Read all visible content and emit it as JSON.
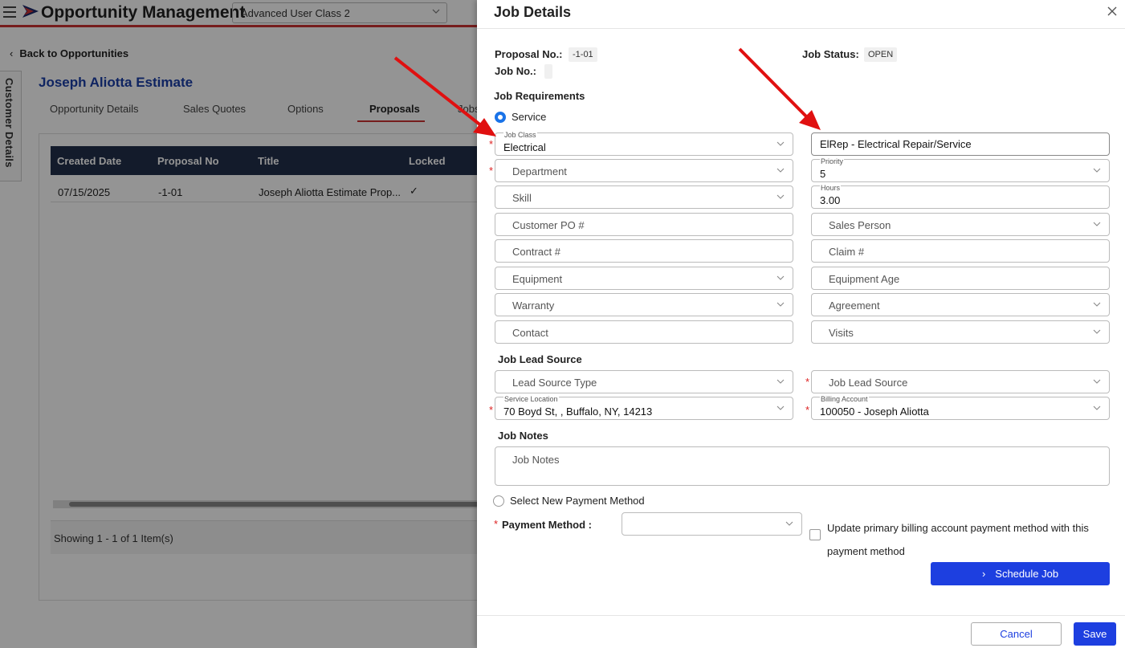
{
  "app": {
    "title": "Opportunity Management",
    "class_select": "Advanced User Class 2",
    "back_link": "Back to Opportunities",
    "side_tab": "Customer Details",
    "customer_title": "Joseph Aliotta Estimate",
    "tabs": [
      {
        "label": "Opportunity Details"
      },
      {
        "label": "Sales Quotes"
      },
      {
        "label": "Options"
      },
      {
        "label": "Proposals",
        "active": true
      },
      {
        "label": "Jobs"
      }
    ],
    "grid": {
      "columns": [
        "Created Date",
        "Proposal No",
        "Title",
        "Locked"
      ],
      "rows": [
        {
          "created": "07/15/2025",
          "proposal_no": "-1-01",
          "title": "Joseph Aliotta Estimate Prop...",
          "locked": "✓"
        }
      ],
      "pager": "Showing 1 - 1 of 1 Item(s)"
    }
  },
  "drawer": {
    "title": "Job Details",
    "proposal_label": "Proposal No.:",
    "proposal_value": "-1-01",
    "job_no_label": "Job No.:",
    "job_no_value": "",
    "job_status_label": "Job Status:",
    "job_status_value": "OPEN",
    "requirements_title": "Job Requirements",
    "service_radio": "Service",
    "job_class": {
      "label": "Job Class",
      "value": "Electrical"
    },
    "job_class_type": "ElRep - Electrical Repair/Service",
    "department": "Department",
    "priority": {
      "label": "Priority",
      "value": "5"
    },
    "skill": "Skill",
    "hours": {
      "label": "Hours",
      "value": "3.00"
    },
    "customer_po": "Customer PO #",
    "sales_person": "Sales Person",
    "contract": "Contract #",
    "claim": "Claim #",
    "equipment": "Equipment",
    "equipment_age": "Equipment Age",
    "warranty": "Warranty",
    "agreement": "Agreement",
    "contact": "Contact",
    "visits": "Visits",
    "lead_source_title": "Job Lead Source",
    "lead_source_type": "Lead Source Type",
    "job_lead_source": "Job Lead Source",
    "service_location": {
      "label": "Service Location",
      "value": "70 Boyd St, , Buffalo, NY, 14213"
    },
    "billing_account": {
      "label": "Billing Account",
      "value": "100050 - Joseph Aliotta"
    },
    "notes_title": "Job Notes",
    "notes_placeholder": "Job Notes",
    "new_payment_radio": "Select New Payment Method",
    "payment_method_label": "Payment Method",
    "update_billing_label": "Update primary billing account payment method with this payment method",
    "schedule_button": "Schedule Job",
    "cancel_button": "Cancel",
    "save_button": "Save"
  },
  "colors": {
    "primary": "#1d3fe0",
    "header_blue": "#1b3ea8",
    "grid_header": "#22304a",
    "annotation_arrow": "#e01010",
    "required": "#d22222"
  }
}
